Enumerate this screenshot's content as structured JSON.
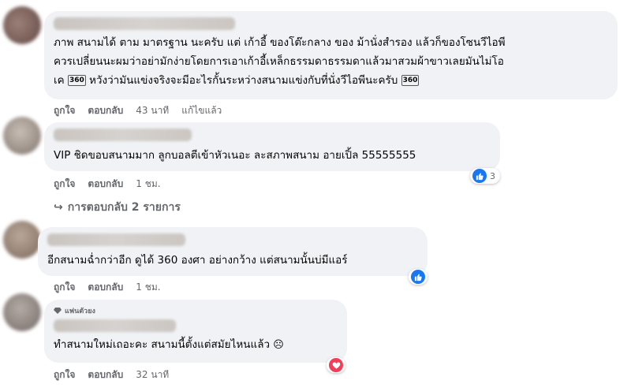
{
  "comments": [
    {
      "text_pre": "ภาพ สนามได้ ตาม มาตรฐาน นะครับ แต่ เก้าอี้ ของโต๊ะกลาง ของ ม้านั่งสำรอง แล้วก็ของโซนวีไอพี\nควรเปลี่ยนนะผมว่าอย่ามักง่ายโดยการเอาเก้าอี้เหล็กธรรมดาธรรมดาแล้วมาสวมผ้าขาวเลยมันไม่โอ\nเค ",
      "emoji_1": "360",
      "text_mid": " หวังว่ามันแข่งจริงจะมีอะไรกั้นระหว่างสนามแข่งกับที่นั่งวีไอพีนะครับ ",
      "emoji_2": "360",
      "like": "ถูกใจ",
      "reply": "ตอบกลับ",
      "time": "43 นาที",
      "edited": "แก้ไขแล้ว"
    },
    {
      "text": "VIP ชิดขอบสนามมาก ลูกบอลตีเข้าหัวเนอะ ละสภาพสนาม อายเปิ้ล 55555555",
      "like": "ถูกใจ",
      "reply": "ตอบกลับ",
      "time": "1 ชม.",
      "reaction_count": "3",
      "replies_label": "การตอบกลับ 2 รายการ"
    },
    {
      "text": "อีกสนามฉ่ำกว่าอีก ดูได้ 360 องศา อย่างกว้าง แต่สนามนั้นบ่มีแอร์",
      "like": "ถูกใจ",
      "reply": "ตอบกลับ",
      "time": "1 ชม."
    },
    {
      "badge": "แฟนตัวยง",
      "text": "ทำสนามใหม่เถอะคะ สนามนี้ตั้งแต่สมัยไหนแล้ว",
      "like": "ถูกใจ",
      "reply": "ตอบกลับ",
      "time": "32 นาที"
    }
  ],
  "colors": {
    "bubble": "#f0f2f5",
    "like": "#1877f2",
    "love": "#f33e58",
    "meta": "#65676b"
  }
}
